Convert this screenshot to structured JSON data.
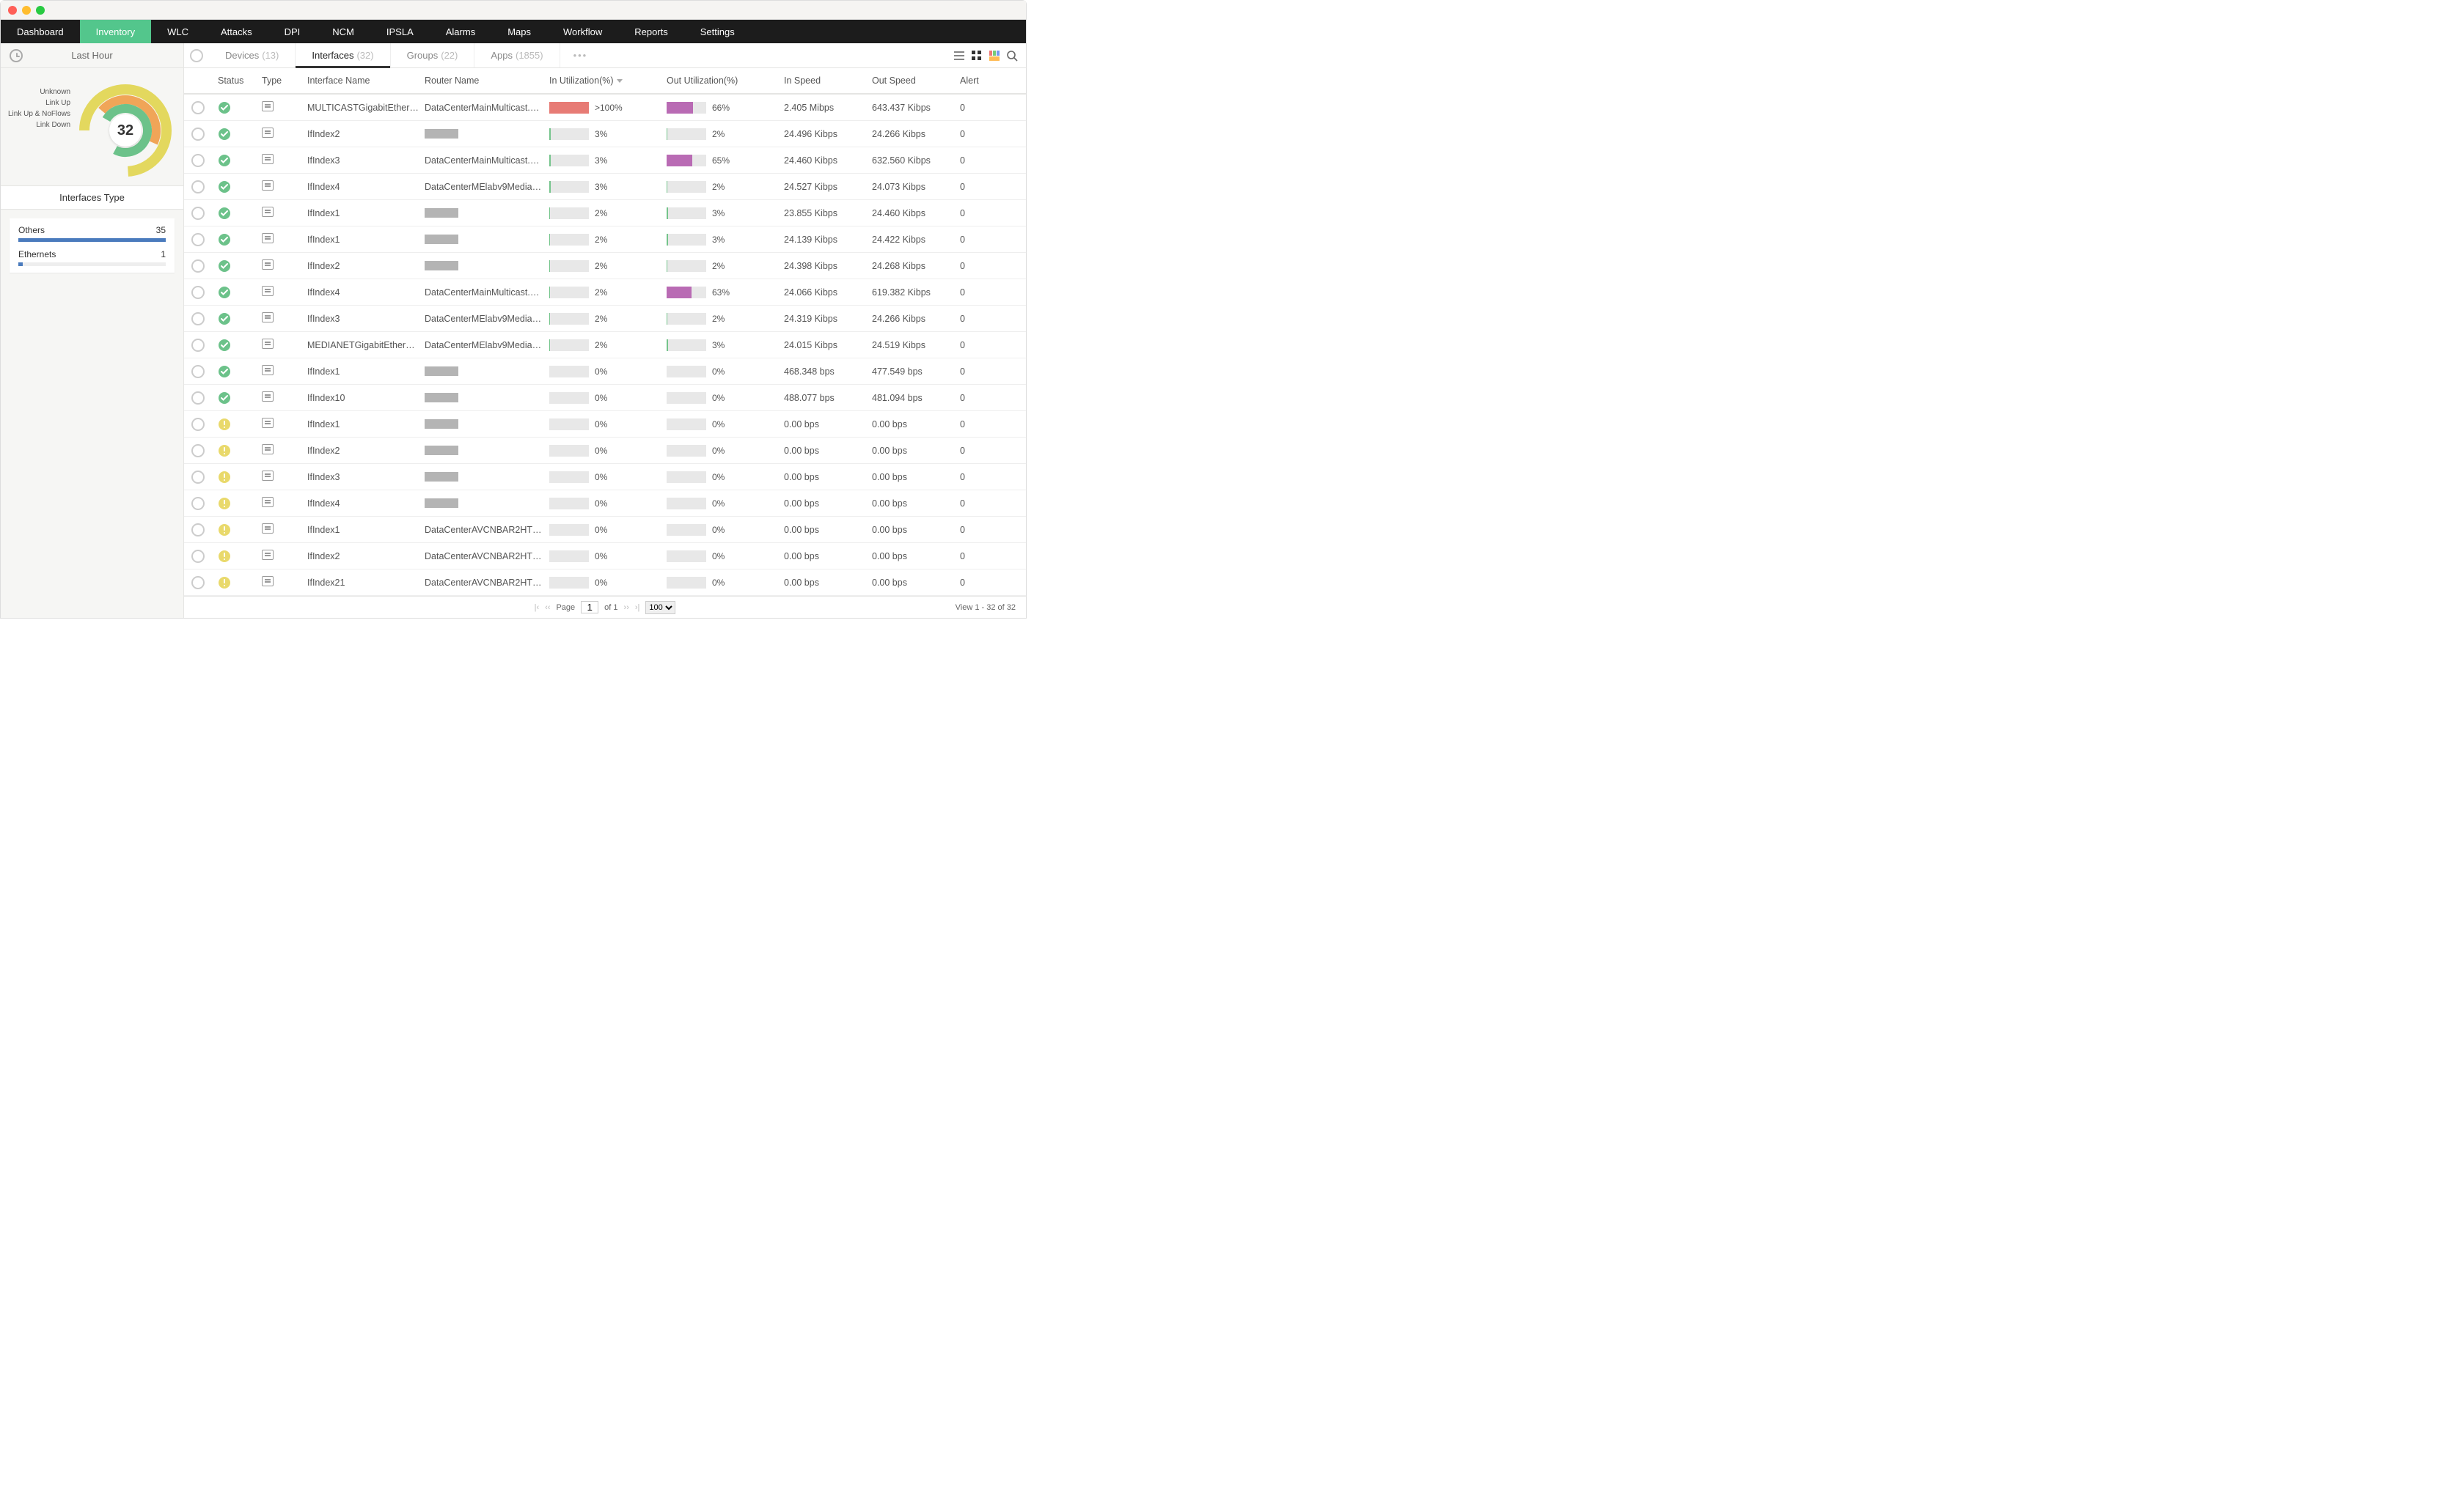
{
  "window": {
    "title_label": "Last Hour"
  },
  "topnav": [
    "Dashboard",
    "Inventory",
    "WLC",
    "Attacks",
    "DPI",
    "NCM",
    "IPSLA",
    "Alarms",
    "Maps",
    "Workflow",
    "Reports",
    "Settings"
  ],
  "topnav_active": 1,
  "sidebar": {
    "time_label": "Last Hour",
    "donut_center": "32",
    "donut_legend": [
      "Unknown",
      "Link Up",
      "Link Up & NoFlows",
      "Link Down"
    ],
    "interfaces_type_header": "Interfaces Type",
    "types": [
      {
        "name": "Others",
        "count": "35",
        "pct": 100
      },
      {
        "name": "Ethernets",
        "count": "1",
        "pct": 3
      }
    ]
  },
  "tabs": [
    {
      "label": "Devices",
      "count": "(13)"
    },
    {
      "label": "Interfaces",
      "count": "(32)"
    },
    {
      "label": "Groups",
      "count": "(22)"
    },
    {
      "label": "Apps",
      "count": "(1855)"
    }
  ],
  "tabs_active": 1,
  "columns": [
    "Status",
    "Type",
    "Interface Name",
    "Router Name",
    "In Utilization(%)",
    "Out Utilization(%)",
    "In Speed",
    "Out Speed",
    "Alert"
  ],
  "sort_col": 4,
  "rows": [
    {
      "status": "ok",
      "iface": "MULTICASTGigabitEthernet...",
      "router": "DataCenterMainMulticast.m...",
      "in": {
        "txt": ">100%",
        "pct": 100,
        "color": "red"
      },
      "out": {
        "txt": "66%",
        "pct": 66,
        "color": "purple"
      },
      "inSpeed": "2.405 Mibps",
      "outSpeed": "643.437 Kibps",
      "alert": "0"
    },
    {
      "status": "ok",
      "iface": "IfIndex2",
      "router": "",
      "in": {
        "txt": "3%",
        "pct": 3,
        "color": "green"
      },
      "out": {
        "txt": "2%",
        "pct": 2,
        "color": "green"
      },
      "inSpeed": "24.496 Kibps",
      "outSpeed": "24.266 Kibps",
      "alert": "0"
    },
    {
      "status": "ok",
      "iface": "IfIndex3",
      "router": "DataCenterMainMulticast.m...",
      "in": {
        "txt": "3%",
        "pct": 3,
        "color": "green"
      },
      "out": {
        "txt": "65%",
        "pct": 65,
        "color": "purple"
      },
      "inSpeed": "24.460 Kibps",
      "outSpeed": "632.560 Kibps",
      "alert": "0"
    },
    {
      "status": "ok",
      "iface": "IfIndex4",
      "router": "DataCenterMElabv9Mediane...",
      "in": {
        "txt": "3%",
        "pct": 3,
        "color": "green"
      },
      "out": {
        "txt": "2%",
        "pct": 2,
        "color": "green"
      },
      "inSpeed": "24.527 Kibps",
      "outSpeed": "24.073 Kibps",
      "alert": "0"
    },
    {
      "status": "ok",
      "iface": "IfIndex1",
      "router": "",
      "in": {
        "txt": "2%",
        "pct": 2,
        "color": "green"
      },
      "out": {
        "txt": "3%",
        "pct": 3,
        "color": "green"
      },
      "inSpeed": "23.855 Kibps",
      "outSpeed": "24.460 Kibps",
      "alert": "0"
    },
    {
      "status": "ok",
      "iface": "IfIndex1",
      "router": "",
      "in": {
        "txt": "2%",
        "pct": 2,
        "color": "green"
      },
      "out": {
        "txt": "3%",
        "pct": 3,
        "color": "green"
      },
      "inSpeed": "24.139 Kibps",
      "outSpeed": "24.422 Kibps",
      "alert": "0"
    },
    {
      "status": "ok",
      "iface": "IfIndex2",
      "router": "",
      "in": {
        "txt": "2%",
        "pct": 2,
        "color": "green"
      },
      "out": {
        "txt": "2%",
        "pct": 2,
        "color": "green"
      },
      "inSpeed": "24.398 Kibps",
      "outSpeed": "24.268 Kibps",
      "alert": "0"
    },
    {
      "status": "ok",
      "iface": "IfIndex4",
      "router": "DataCenterMainMulticast.m...",
      "in": {
        "txt": "2%",
        "pct": 2,
        "color": "green"
      },
      "out": {
        "txt": "63%",
        "pct": 63,
        "color": "purple"
      },
      "inSpeed": "24.066 Kibps",
      "outSpeed": "619.382 Kibps",
      "alert": "0"
    },
    {
      "status": "ok",
      "iface": "IfIndex3",
      "router": "DataCenterMElabv9Mediane...",
      "in": {
        "txt": "2%",
        "pct": 2,
        "color": "green"
      },
      "out": {
        "txt": "2%",
        "pct": 2,
        "color": "green"
      },
      "inSpeed": "24.319 Kibps",
      "outSpeed": "24.266 Kibps",
      "alert": "0"
    },
    {
      "status": "ok",
      "iface": "MEDIANETGigabitEthernetm...",
      "router": "DataCenterMElabv9Mediane...",
      "in": {
        "txt": "2%",
        "pct": 2,
        "color": "green"
      },
      "out": {
        "txt": "3%",
        "pct": 3,
        "color": "green"
      },
      "inSpeed": "24.015 Kibps",
      "outSpeed": "24.519 Kibps",
      "alert": "0"
    },
    {
      "status": "ok",
      "iface": "IfIndex1",
      "router": "",
      "in": {
        "txt": "0%",
        "pct": 0,
        "color": "green"
      },
      "out": {
        "txt": "0%",
        "pct": 0,
        "color": "green"
      },
      "inSpeed": "468.348 bps",
      "outSpeed": "477.549 bps",
      "alert": "0"
    },
    {
      "status": "ok",
      "iface": "IfIndex10",
      "router": "",
      "in": {
        "txt": "0%",
        "pct": 0,
        "color": "green"
      },
      "out": {
        "txt": "0%",
        "pct": 0,
        "color": "green"
      },
      "inSpeed": "488.077 bps",
      "outSpeed": "481.094 bps",
      "alert": "0"
    },
    {
      "status": "warn",
      "iface": "IfIndex1",
      "router": "",
      "in": {
        "txt": "0%",
        "pct": 0,
        "color": "green"
      },
      "out": {
        "txt": "0%",
        "pct": 0,
        "color": "green"
      },
      "inSpeed": "0.00 bps",
      "outSpeed": "0.00 bps",
      "alert": "0"
    },
    {
      "status": "warn",
      "iface": "IfIndex2",
      "router": "",
      "in": {
        "txt": "0%",
        "pct": 0,
        "color": "green"
      },
      "out": {
        "txt": "0%",
        "pct": 0,
        "color": "green"
      },
      "inSpeed": "0.00 bps",
      "outSpeed": "0.00 bps",
      "alert": "0"
    },
    {
      "status": "warn",
      "iface": "IfIndex3",
      "router": "",
      "in": {
        "txt": "0%",
        "pct": 0,
        "color": "green"
      },
      "out": {
        "txt": "0%",
        "pct": 0,
        "color": "green"
      },
      "inSpeed": "0.00 bps",
      "outSpeed": "0.00 bps",
      "alert": "0"
    },
    {
      "status": "warn",
      "iface": "IfIndex4",
      "router": "",
      "in": {
        "txt": "0%",
        "pct": 0,
        "color": "green"
      },
      "out": {
        "txt": "0%",
        "pct": 0,
        "color": "green"
      },
      "inSpeed": "0.00 bps",
      "outSpeed": "0.00 bps",
      "alert": "0"
    },
    {
      "status": "warn",
      "iface": "IfIndex1",
      "router": "DataCenterAVCNBAR2HTTP...",
      "in": {
        "txt": "0%",
        "pct": 0,
        "color": "green"
      },
      "out": {
        "txt": "0%",
        "pct": 0,
        "color": "green"
      },
      "inSpeed": "0.00 bps",
      "outSpeed": "0.00 bps",
      "alert": "0"
    },
    {
      "status": "warn",
      "iface": "IfIndex2",
      "router": "DataCenterAVCNBAR2HTTP...",
      "in": {
        "txt": "0%",
        "pct": 0,
        "color": "green"
      },
      "out": {
        "txt": "0%",
        "pct": 0,
        "color": "green"
      },
      "inSpeed": "0.00 bps",
      "outSpeed": "0.00 bps",
      "alert": "0"
    },
    {
      "status": "warn",
      "iface": "IfIndex21",
      "router": "DataCenterAVCNBAR2HTTP...",
      "in": {
        "txt": "0%",
        "pct": 0,
        "color": "green"
      },
      "out": {
        "txt": "0%",
        "pct": 0,
        "color": "green"
      },
      "inSpeed": "0.00 bps",
      "outSpeed": "0.00 bps",
      "alert": "0"
    }
  ],
  "pager": {
    "page_label": "Page",
    "page_value": "1",
    "of_label": "of 1",
    "per_page": "100",
    "summary": "View 1 - 32 of 32"
  },
  "chart_data": {
    "type": "pie",
    "title": "Interface Status",
    "series": [
      {
        "name": "Unknown",
        "value": 0,
        "color": "#cccccc"
      },
      {
        "name": "Link Up",
        "value": 12,
        "color": "#6cc28a"
      },
      {
        "name": "Link Up & NoFlows",
        "value": 7,
        "color": "#f0a558"
      },
      {
        "name": "Link Down",
        "value": 13,
        "color": "#e3d85e"
      }
    ],
    "total_label": "32"
  }
}
